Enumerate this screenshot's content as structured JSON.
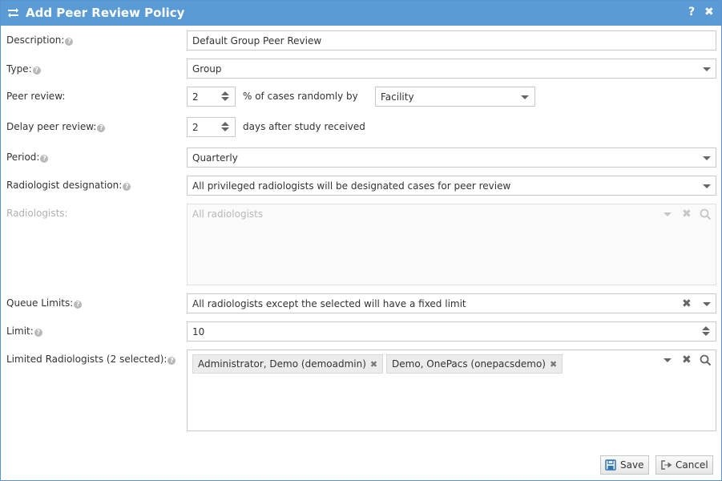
{
  "dialog": {
    "title": "Add Peer Review Policy",
    "help_label": "?",
    "close_label": "✖"
  },
  "help_mark": "?",
  "description": {
    "label": "Description:",
    "value": "Default Group Peer Review"
  },
  "type": {
    "label": "Type:",
    "value": "Group"
  },
  "peer_review": {
    "label": "Peer review:",
    "value": "2",
    "middle_text": "% of cases randomly by",
    "by_value": "Facility"
  },
  "delay": {
    "label": "Delay peer review:",
    "value": "2",
    "suffix": "days after study received"
  },
  "period": {
    "label": "Period:",
    "value": "Quarterly"
  },
  "designation": {
    "label": "Radiologist designation:",
    "value": "All privileged radiologists will be designated cases for peer review"
  },
  "radiologists": {
    "label": "Radiologists:",
    "placeholder": "All radiologists"
  },
  "queue_limits": {
    "label": "Queue Limits:",
    "value": "All radiologists except the selected will have a fixed limit"
  },
  "limit": {
    "label": "Limit:",
    "value": "10"
  },
  "limited": {
    "label": "Limited Radiologists (2 selected):",
    "tags": [
      {
        "text": "Administrator, Demo (demoadmin)",
        "remove": "✖"
      },
      {
        "text": "Demo, OnePacs (onepacsdemo)",
        "remove": "✖"
      }
    ]
  },
  "footer": {
    "save_label": "Save",
    "cancel_label": "Cancel"
  },
  "colors": {
    "titlebar": "#5b9bd5",
    "accent_icon": "#2e75b6"
  }
}
